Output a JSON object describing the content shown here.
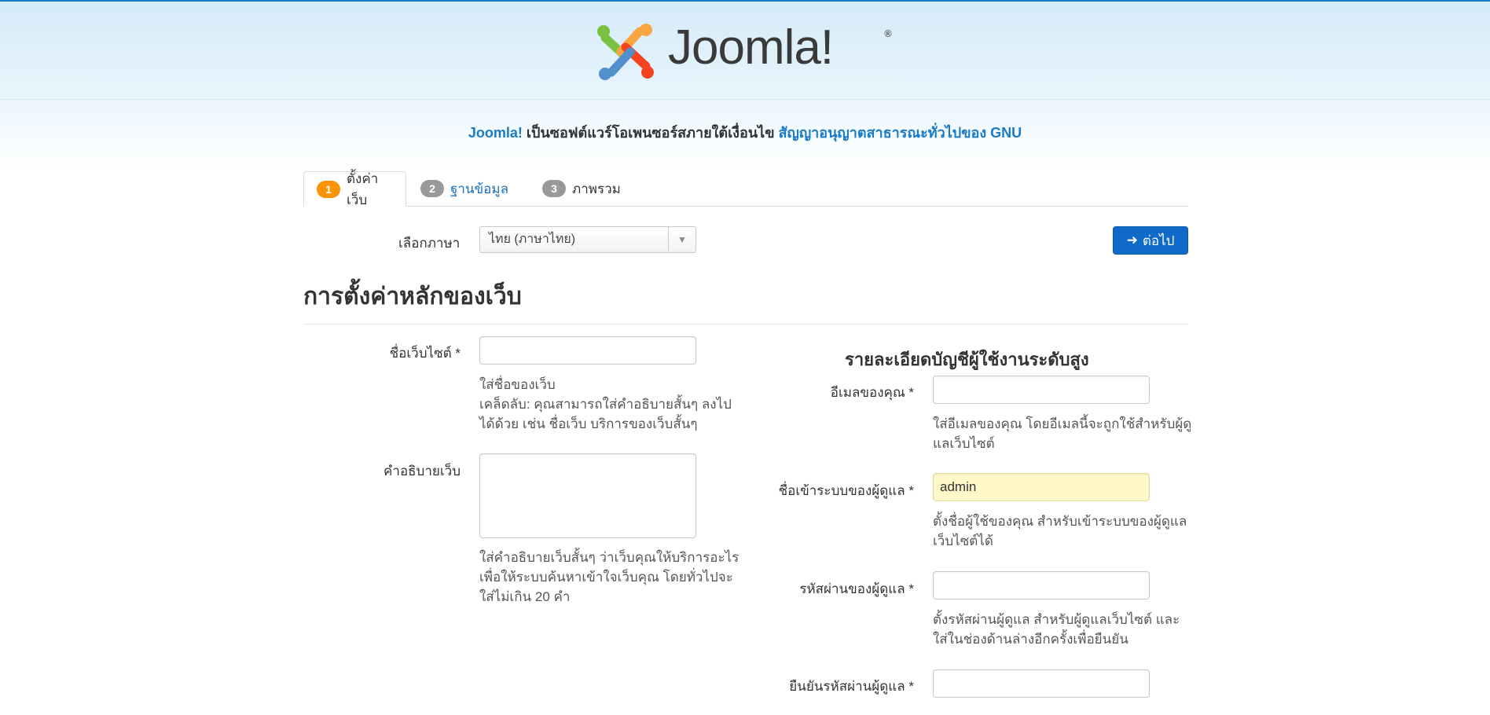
{
  "header": {
    "logo_text": "Joomla!",
    "logo_reg": "®",
    "license_prefix": "Joomla!",
    "license_middle": " เป็นซอฟต์แวร์โอเพนซอร์สภายใต้เงื่อนไข ",
    "license_link": "สัญญาอนุญาตสาธารณะทั่วไปของ GNU"
  },
  "tabs": [
    {
      "num": "1",
      "label": "ตั้งค่าเว็บ"
    },
    {
      "num": "2",
      "label": "ฐานข้อมูล"
    },
    {
      "num": "3",
      "label": "ภาพรวม"
    }
  ],
  "language": {
    "label": "เลือกภาษา",
    "selected": "ไทย (ภาษาไทย)"
  },
  "next_button": "ต่อไป",
  "page_title": "การตั้งค่าหลักของเว็บ",
  "site": {
    "name_label": "ชื่อเว็บไซต์ *",
    "name_value": "",
    "name_help_1": "ใส่ชื่อของเว็บ",
    "name_help_2": "เคล็ดลับ: คุณสามารถใส่คำอธิบายสั้นๆ ลงไป",
    "name_help_3": "ได้ด้วย เช่น ชื่อเว็บ บริการของเว็บสั้นๆ",
    "desc_label": "คำอธิบายเว็บ",
    "desc_value": "",
    "desc_help_1": "ใส่คำอธิบายเว็บสั้นๆ ว่าเว็บคุณให้บริการอะไร",
    "desc_help_2": "เพื่อให้ระบบค้นหาเข้าใจเว็บคุณ โดยทั่วไปจะ",
    "desc_help_3": "ใส่ไม่เกิน 20 คำ"
  },
  "admin": {
    "section_title": "รายละเอียดบัญชีผู้ใช้งานระดับสูง",
    "email_label": "อีเมลของคุณ *",
    "email_value": "",
    "email_help_1": "ใส่อีเมลของคุณ โดยอีเมลนี้จะถูกใช้สำหรับผู้ดู",
    "email_help_2": "แลเว็บไซต์",
    "username_label": "ชื่อเข้าระบบของผู้ดูแล *",
    "username_value": "admin",
    "username_help_1": "ตั้งชื่อผู้ใช้ของคุณ สำหรับเข้าระบบของผู้ดูแล",
    "username_help_2": "เว็บไซต์ได้",
    "password_label": "รหัสผ่านของผู้ดูแล *",
    "password_value": "",
    "password_help_1": "ตั้งรหัสผ่านผู้ดูแล สำหรับผู้ดูแลเว็บไซต์ และ",
    "password_help_2": "ใส่ในช่องด้านล่างอีกครั้งเพื่อยืนยัน",
    "confirm_label": "ยืนยันรหัสผ่านผู้ดูแล *",
    "confirm_value": ""
  },
  "colors": {
    "accent": "#0f6bc7",
    "active_badge": "#f89406",
    "link": "#1a7bc7"
  }
}
